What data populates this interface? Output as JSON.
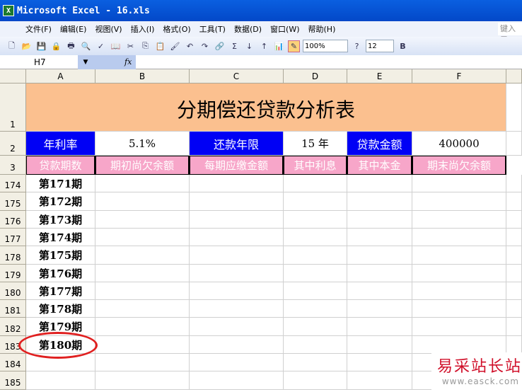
{
  "window": {
    "title": "Microsoft Excel - 16.xls"
  },
  "menu": {
    "items": [
      "文件(F)",
      "编辑(E)",
      "视图(V)",
      "插入(I)",
      "格式(O)",
      "工具(T)",
      "数据(D)",
      "窗口(W)",
      "帮助(H)"
    ],
    "help_box": "键入需"
  },
  "toolbar": {
    "zoom": "100%",
    "font_size": "12",
    "bold": "B"
  },
  "formula_bar": {
    "name_box": "H7",
    "fx": "fx",
    "value": ""
  },
  "columns": [
    "A",
    "B",
    "C",
    "D",
    "E",
    "F"
  ],
  "sheet": {
    "title": "分期偿还贷款分析表",
    "row2": {
      "rate_label": "年利率",
      "rate": "5.1%",
      "term_label": "还款年限",
      "term": "15 年",
      "amount_label": "贷款金额",
      "amount": "400000"
    },
    "headers": [
      "贷款期数",
      "期初尚欠余额",
      "每期应缴金额",
      "其中利息",
      "其中本金",
      "期末尚欠余额"
    ],
    "row_numbers": [
      "1",
      "2",
      "3"
    ],
    "rows": [
      {
        "n": "174",
        "a": "第171期"
      },
      {
        "n": "175",
        "a": "第172期"
      },
      {
        "n": "176",
        "a": "第173期"
      },
      {
        "n": "177",
        "a": "第174期"
      },
      {
        "n": "178",
        "a": "第175期"
      },
      {
        "n": "179",
        "a": "第176期"
      },
      {
        "n": "180",
        "a": "第177期"
      },
      {
        "n": "181",
        "a": "第178期"
      },
      {
        "n": "182",
        "a": "第179期"
      },
      {
        "n": "183",
        "a": "第180期"
      },
      {
        "n": "184",
        "a": ""
      },
      {
        "n": "185",
        "a": ""
      }
    ]
  },
  "watermark": {
    "name": "易采站长站",
    "url": "www.easck.com"
  },
  "colors": {
    "title_bg": "#fbc08f",
    "label_bg": "#0000f5",
    "header_bg": "#f7a6c9",
    "highlight": "#e02020"
  }
}
